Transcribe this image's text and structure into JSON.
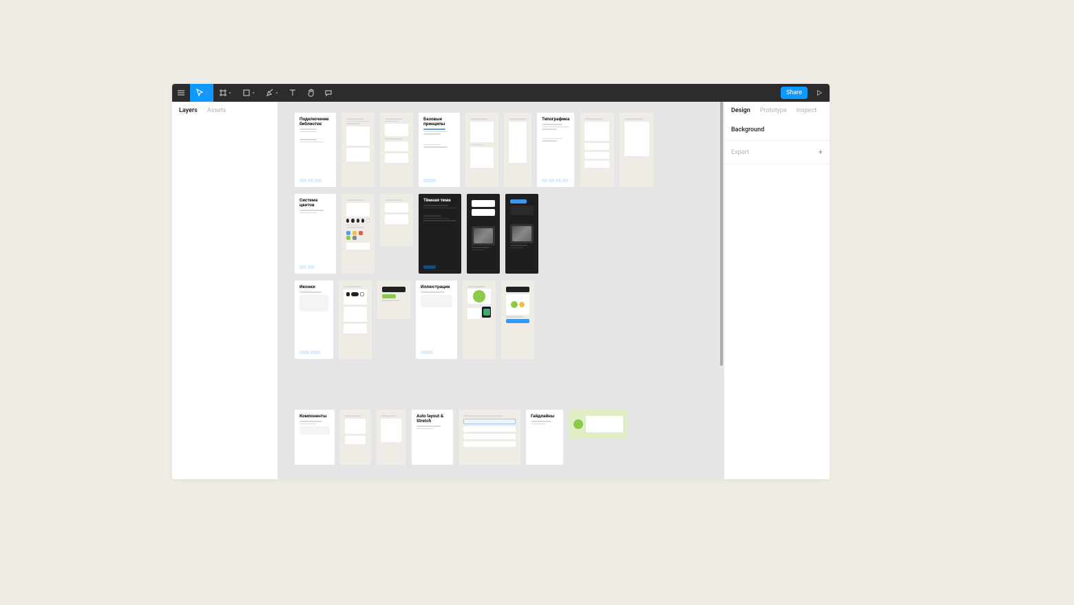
{
  "toolbar": {
    "share_label": "Share"
  },
  "left_panel": {
    "tabs": {
      "layers": "Layers",
      "assets": "Assets"
    }
  },
  "right_panel": {
    "tabs": {
      "design": "Design",
      "prototype": "Prototype",
      "inspect": "Inspect"
    },
    "background_label": "Background",
    "export_label": "Export"
  },
  "frames": {
    "r1": {
      "f1_title": "Подключение библиотек",
      "f2_title": "Базовые принципы",
      "f3_title": "Типографика"
    },
    "r2": {
      "f1_title": "Система цветов",
      "f2_title": "Тёмная тема"
    },
    "r3": {
      "f1_title": "Иконки",
      "f2_title": "Иллюстрации"
    },
    "r4": {
      "f1_title": "Компоненты",
      "f2_title": "Auto layout & Stretch",
      "f3_title": "Гайдлайны"
    }
  }
}
